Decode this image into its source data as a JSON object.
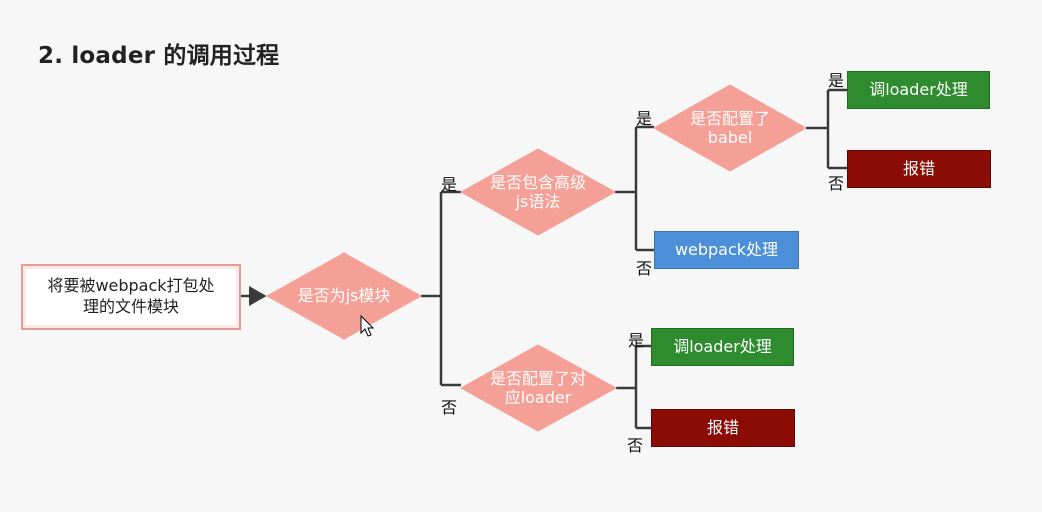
{
  "title": "2. loader 的调用过程",
  "start": "将要被webpack打包处理的文件模块",
  "decisions": {
    "is_js": "是否为js模块",
    "has_advanced": "是否包含高级js语法",
    "babel_configured": "是否配置了babel",
    "loader_configured": "是否配置了对应loader"
  },
  "outcomes": {
    "babel_yes": "调loader处理",
    "babel_no": "报错",
    "webpack": "webpack处理",
    "loader_yes": "调loader处理",
    "loader_no": "报错"
  },
  "labels": {
    "yes": "是",
    "no": "否"
  },
  "colors": {
    "diamond": "#f4a097",
    "green": "#2e8b2e",
    "blue": "#4a8fd8",
    "red": "#8b0b05",
    "connector": "#3a3a3a"
  }
}
